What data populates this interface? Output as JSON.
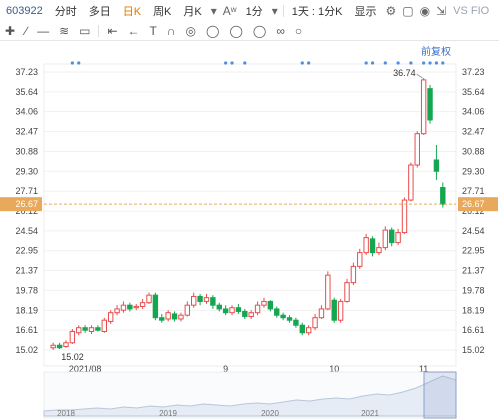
{
  "toolbar": {
    "stock_code": "603922",
    "tabs": [
      "分时",
      "多日",
      "日K",
      "周K",
      "月K"
    ],
    "active_tab": "日K",
    "interval": "1分",
    "combo": "1天 : 1分K",
    "display": "显示",
    "compare": "VS FIO"
  },
  "adjust_label": "前复权",
  "chart_data": {
    "type": "candlestick",
    "y_ticks": [
      "37.23",
      "35.64",
      "34.06",
      "32.47",
      "30.88",
      "29.30",
      "27.71",
      "26.12",
      "24.54",
      "22.95",
      "21.37",
      "19.78",
      "18.19",
      "16.61",
      "15.02"
    ],
    "ylim": [
      15.02,
      37.23
    ],
    "current_price": "26.67",
    "x_labels": [
      "2021/08",
      "9",
      "10",
      "11"
    ],
    "high_label": "36.74",
    "low_label": "15.02",
    "colors": {
      "up": "#e84d4d",
      "down": "#14a650",
      "last": "#e8a95c"
    },
    "candles": [
      {
        "o": 15.2,
        "c": 15.4,
        "h": 15.6,
        "l": 15.02
      },
      {
        "o": 15.4,
        "c": 15.2,
        "h": 15.6,
        "l": 15.1
      },
      {
        "o": 15.3,
        "c": 15.6,
        "h": 15.8,
        "l": 15.2
      },
      {
        "o": 15.6,
        "c": 16.5,
        "h": 16.7,
        "l": 15.5
      },
      {
        "o": 16.4,
        "c": 16.8,
        "h": 17.0,
        "l": 16.2
      },
      {
        "o": 16.8,
        "c": 16.6,
        "h": 17.0,
        "l": 16.4
      },
      {
        "o": 16.5,
        "c": 16.8,
        "h": 17.0,
        "l": 16.3
      },
      {
        "o": 16.8,
        "c": 16.6,
        "h": 17.0,
        "l": 16.5
      },
      {
        "o": 16.5,
        "c": 17.4,
        "h": 17.6,
        "l": 16.4
      },
      {
        "o": 17.3,
        "c": 18.0,
        "h": 18.2,
        "l": 17.1
      },
      {
        "o": 18.0,
        "c": 18.3,
        "h": 18.6,
        "l": 17.8
      },
      {
        "o": 18.2,
        "c": 18.6,
        "h": 18.9,
        "l": 18.0
      },
      {
        "o": 18.6,
        "c": 18.3,
        "h": 18.8,
        "l": 18.1
      },
      {
        "o": 18.4,
        "c": 18.5,
        "h": 18.7,
        "l": 18.2
      },
      {
        "o": 18.5,
        "c": 18.8,
        "h": 19.1,
        "l": 18.3
      },
      {
        "o": 18.8,
        "c": 19.4,
        "h": 19.6,
        "l": 18.7
      },
      {
        "o": 19.4,
        "c": 17.6,
        "h": 19.6,
        "l": 17.4
      },
      {
        "o": 17.6,
        "c": 17.4,
        "h": 17.9,
        "l": 17.2
      },
      {
        "o": 17.5,
        "c": 18.0,
        "h": 18.2,
        "l": 17.3
      },
      {
        "o": 17.9,
        "c": 17.5,
        "h": 18.1,
        "l": 17.3
      },
      {
        "o": 17.5,
        "c": 17.8,
        "h": 18.0,
        "l": 17.3
      },
      {
        "o": 17.8,
        "c": 18.6,
        "h": 18.9,
        "l": 17.7
      },
      {
        "o": 18.6,
        "c": 19.3,
        "h": 19.6,
        "l": 18.4
      },
      {
        "o": 19.3,
        "c": 18.9,
        "h": 19.5,
        "l": 18.6
      },
      {
        "o": 18.9,
        "c": 19.2,
        "h": 19.5,
        "l": 18.7
      },
      {
        "o": 19.2,
        "c": 18.6,
        "h": 19.4,
        "l": 18.3
      },
      {
        "o": 18.6,
        "c": 18.3,
        "h": 18.8,
        "l": 18.1
      },
      {
        "o": 18.3,
        "c": 18.0,
        "h": 18.6,
        "l": 17.8
      },
      {
        "o": 18.0,
        "c": 18.4,
        "h": 18.6,
        "l": 17.8
      },
      {
        "o": 18.4,
        "c": 18.1,
        "h": 18.7,
        "l": 17.9
      },
      {
        "o": 18.1,
        "c": 17.7,
        "h": 18.3,
        "l": 17.5
      },
      {
        "o": 17.7,
        "c": 18.0,
        "h": 18.2,
        "l": 17.5
      },
      {
        "o": 18.0,
        "c": 18.6,
        "h": 18.9,
        "l": 17.8
      },
      {
        "o": 18.6,
        "c": 18.9,
        "h": 19.2,
        "l": 18.4
      },
      {
        "o": 18.9,
        "c": 18.3,
        "h": 19.0,
        "l": 18.1
      },
      {
        "o": 18.3,
        "c": 17.8,
        "h": 18.5,
        "l": 17.6
      },
      {
        "o": 17.8,
        "c": 17.6,
        "h": 18.0,
        "l": 17.4
      },
      {
        "o": 17.6,
        "c": 17.4,
        "h": 17.8,
        "l": 17.2
      },
      {
        "o": 17.4,
        "c": 17.0,
        "h": 17.6,
        "l": 16.8
      },
      {
        "o": 17.0,
        "c": 16.4,
        "h": 17.2,
        "l": 16.2
      },
      {
        "o": 16.4,
        "c": 16.8,
        "h": 17.0,
        "l": 16.2
      },
      {
        "o": 16.8,
        "c": 17.6,
        "h": 17.9,
        "l": 16.6
      },
      {
        "o": 17.6,
        "c": 18.3,
        "h": 18.6,
        "l": 17.5
      },
      {
        "o": 18.3,
        "c": 21.0,
        "h": 21.3,
        "l": 18.2
      },
      {
        "o": 19.0,
        "c": 17.4,
        "h": 19.2,
        "l": 17.2
      },
      {
        "o": 17.4,
        "c": 18.9,
        "h": 19.1,
        "l": 17.2
      },
      {
        "o": 18.9,
        "c": 20.4,
        "h": 20.7,
        "l": 18.8
      },
      {
        "o": 20.4,
        "c": 21.7,
        "h": 22.0,
        "l": 20.2
      },
      {
        "o": 21.7,
        "c": 22.8,
        "h": 23.1,
        "l": 21.5
      },
      {
        "o": 22.8,
        "c": 24.0,
        "h": 24.3,
        "l": 22.6
      },
      {
        "o": 23.9,
        "c": 22.8,
        "h": 24.1,
        "l": 22.5
      },
      {
        "o": 22.8,
        "c": 23.2,
        "h": 23.6,
        "l": 22.6
      },
      {
        "o": 23.2,
        "c": 24.6,
        "h": 24.9,
        "l": 23.0
      },
      {
        "o": 24.6,
        "c": 23.6,
        "h": 24.8,
        "l": 23.3
      },
      {
        "o": 23.6,
        "c": 24.4,
        "h": 24.7,
        "l": 23.4
      },
      {
        "o": 24.4,
        "c": 27.0,
        "h": 27.2,
        "l": 24.3
      },
      {
        "o": 27.0,
        "c": 29.8,
        "h": 30.0,
        "l": 26.9
      },
      {
        "o": 29.8,
        "c": 32.3,
        "h": 32.5,
        "l": 29.6
      },
      {
        "o": 32.3,
        "c": 36.6,
        "h": 36.74,
        "l": 32.2
      },
      {
        "o": 35.9,
        "c": 33.4,
        "h": 36.2,
        "l": 33.1
      },
      {
        "o": 30.2,
        "c": 29.3,
        "h": 31.4,
        "l": 28.6
      },
      {
        "o": 28.0,
        "c": 26.67,
        "h": 28.4,
        "l": 26.4
      }
    ]
  }
}
